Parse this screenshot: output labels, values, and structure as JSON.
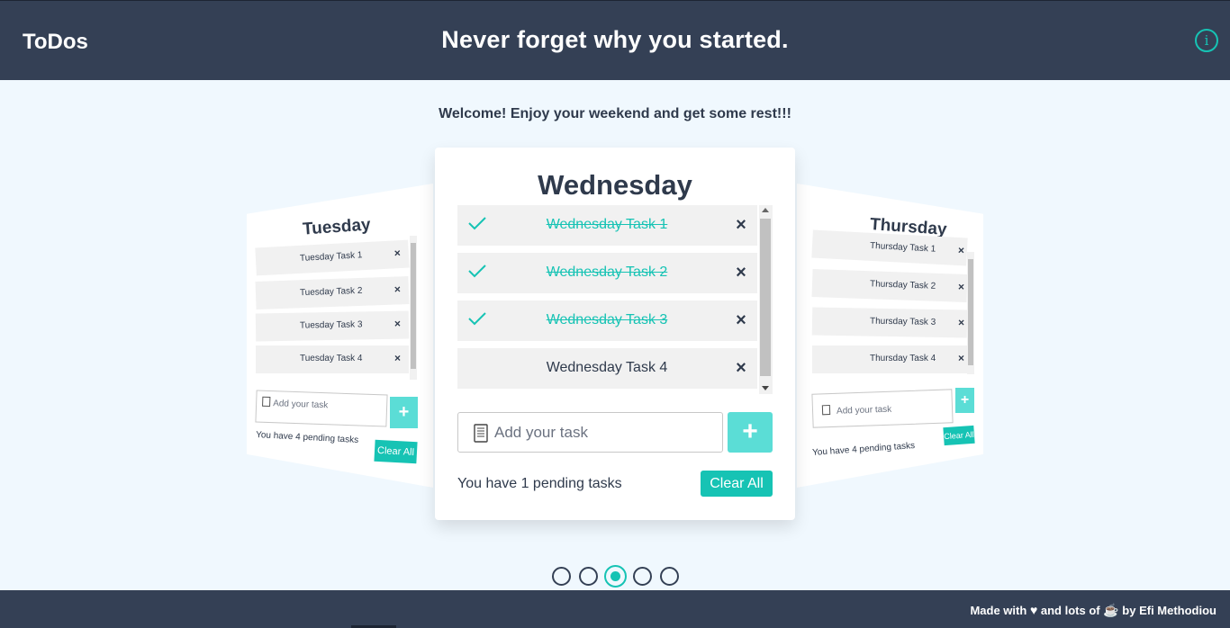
{
  "header": {
    "logo": "ToDos",
    "slogan": "Never forget why you started.",
    "info_icon": "i"
  },
  "welcome": "Welcome! Enjoy your weekend and get some rest!!!",
  "main_card": {
    "day": "Wednesday",
    "tasks": [
      {
        "text": "Wednesday Task 1",
        "done": true
      },
      {
        "text": "Wednesday Task 2",
        "done": true
      },
      {
        "text": "Wednesday Task 3",
        "done": true
      },
      {
        "text": "Wednesday Task 4",
        "done": false
      }
    ],
    "delete_icon": "×",
    "input_placeholder": "Add your task",
    "add_label": "+",
    "pending": "You have 1 pending tasks",
    "clear_label": "Clear All"
  },
  "left_card": {
    "day": "Tuesday",
    "tasks": [
      "Tuesday Task 1",
      "Tuesday Task 2",
      "Tuesday Task 3",
      "Tuesday Task 4"
    ],
    "delete_icon": "×",
    "input_placeholder": "Add your task",
    "add_label": "+",
    "pending": "You have 4 pending tasks",
    "clear_label": "Clear All"
  },
  "right_card": {
    "day": "Thursday",
    "tasks": [
      "Thursday Task 1",
      "Thursday Task 2",
      "Thursday Task 3",
      "Thursday Task 4"
    ],
    "delete_icon": "×",
    "input_placeholder": "Add your task",
    "add_label": "+",
    "pending": "You have 4 pending tasks",
    "clear_label": "Clear All"
  },
  "pagination": {
    "count": 5,
    "active_index": 2
  },
  "footer": {
    "made_with": "Made with",
    "and_lots_of": "and lots of",
    "by": "by Efi Methodiou",
    "heart_icon": "♥",
    "coffee_icon": "☕"
  },
  "colors": {
    "header_bg": "#344055",
    "accent": "#16c3b4",
    "add_button": "#5bddd6",
    "page_bg": "#f0f8fe"
  }
}
